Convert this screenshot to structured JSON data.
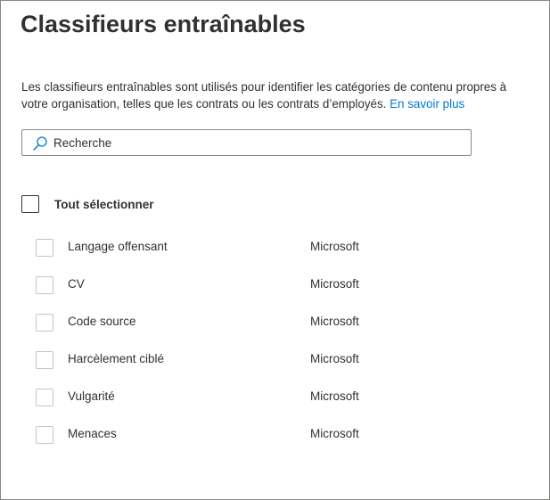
{
  "page": {
    "title": "Classifieurs entraînables",
    "description": "Les classifieurs entraînables sont utilisés pour identifier les catégories de contenu propres à votre organisation, telles que les contrats ou les contrats d’employés.",
    "learn_more": "En savoir plus"
  },
  "search": {
    "placeholder": "Recherche",
    "icon": "search-icon"
  },
  "select_all": {
    "label": "Tout sélectionner",
    "checked": false
  },
  "classifiers": [
    {
      "name": "Langage offensant",
      "publisher": "Microsoft",
      "checked": false
    },
    {
      "name": "CV",
      "publisher": "Microsoft",
      "checked": false
    },
    {
      "name": "Code source",
      "publisher": "Microsoft",
      "checked": false
    },
    {
      "name": "Harcèlement ciblé",
      "publisher": "Microsoft",
      "checked": false
    },
    {
      "name": "Vulgarité",
      "publisher": "Microsoft",
      "checked": false
    },
    {
      "name": "Menaces",
      "publisher": "Microsoft",
      "checked": false
    }
  ],
  "colors": {
    "text": "#323130",
    "link": "#0078d4",
    "border": "#8a8886",
    "checkbox_border": "#c8c6c4"
  }
}
